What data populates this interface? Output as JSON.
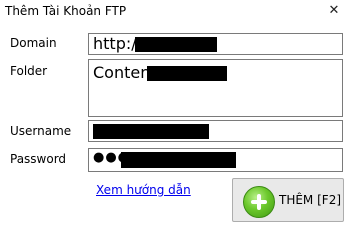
{
  "window": {
    "title": "Thêm Tài Khoản FTP",
    "close_glyph": "✕"
  },
  "form": {
    "domain_label": "Domain",
    "domain_value": "http://",
    "folder_label": "Folder",
    "folder_value": "Content",
    "username_label": "Username",
    "username_value": "",
    "password_label": "Password",
    "password_value": "●●●"
  },
  "help_link": "Xem hướng dẫn",
  "add_button": {
    "label": "THÊM [F2]",
    "icon": "plus-circle-icon",
    "icon_color": "#5cb82a"
  }
}
